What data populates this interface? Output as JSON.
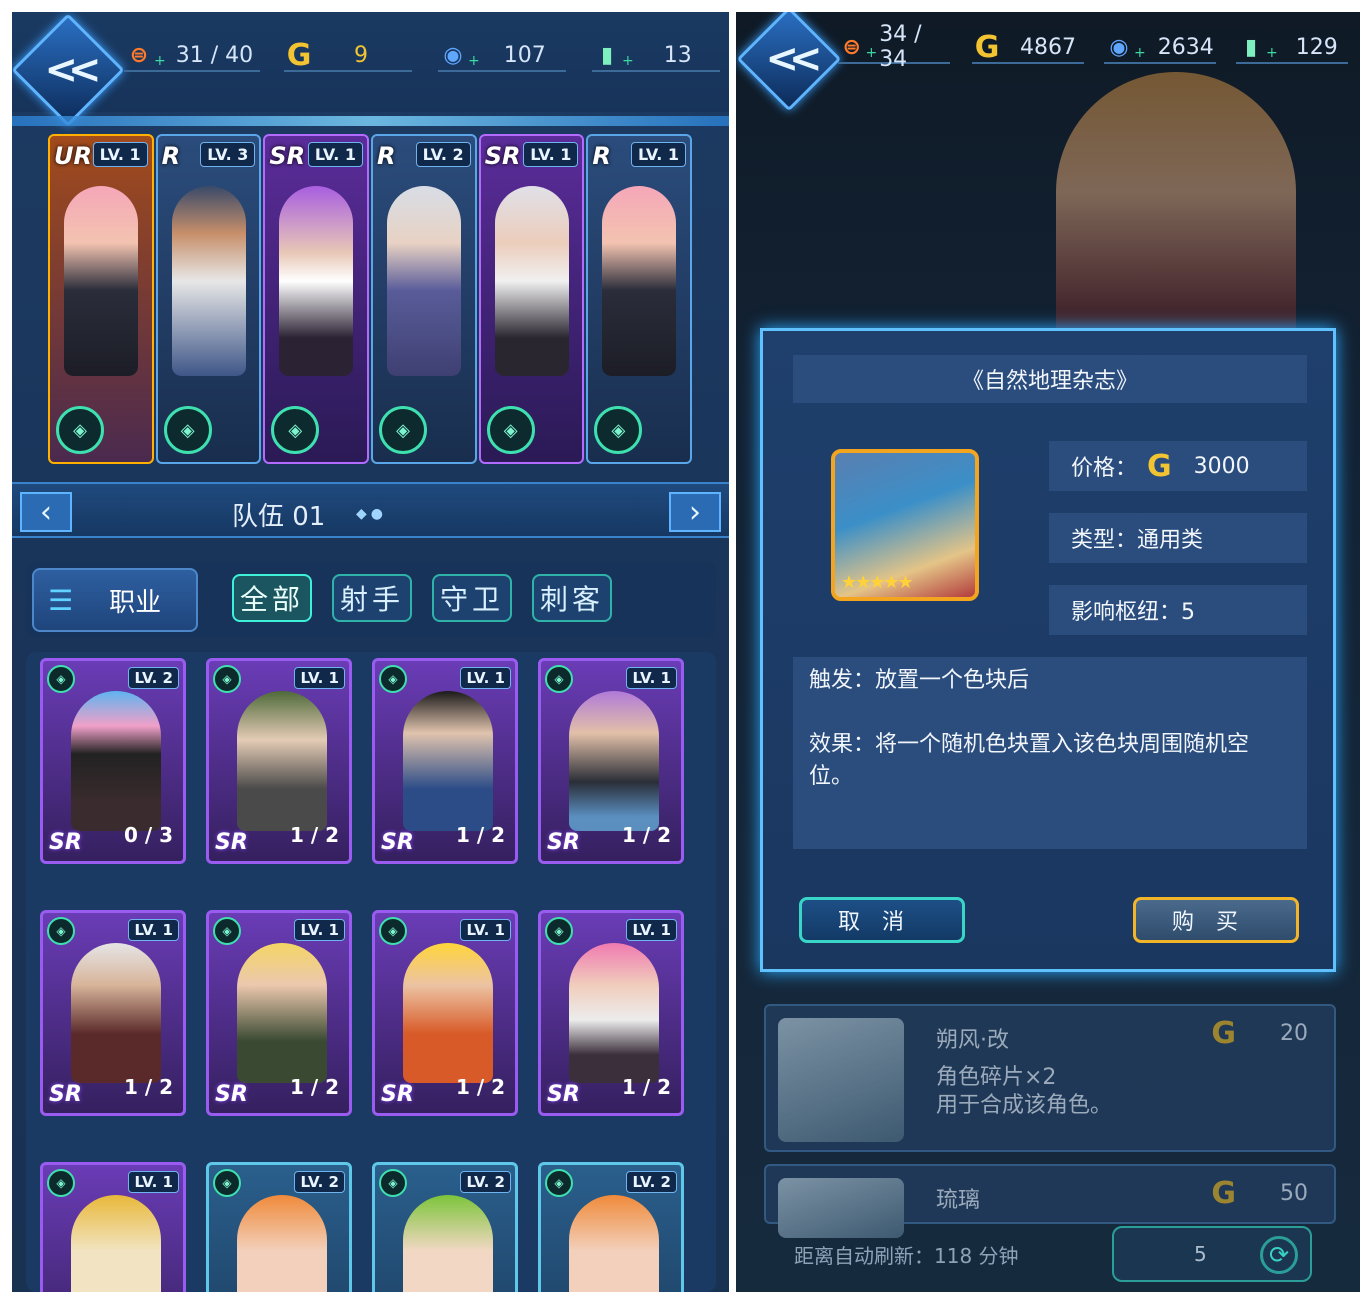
{
  "left_screen": {
    "resources": [
      {
        "icon": "stamina-icon",
        "value": "31 / 40",
        "color": "#ff7a2a"
      },
      {
        "icon": "gold-coin-icon",
        "value": "9",
        "color": "#f2c431"
      },
      {
        "icon": "gem-icon",
        "value": "107",
        "color": "#5fa6ff"
      },
      {
        "icon": "bottle-icon",
        "value": "13",
        "color": "#7ef0c0"
      }
    ],
    "team": [
      {
        "rarity": "UR",
        "level": "LV. 1"
      },
      {
        "rarity": "R",
        "level": "LV. 3"
      },
      {
        "rarity": "SR",
        "level": "LV. 1"
      },
      {
        "rarity": "R",
        "level": "LV. 2"
      },
      {
        "rarity": "SR",
        "level": "LV. 1"
      },
      {
        "rarity": "R",
        "level": "LV. 1"
      }
    ],
    "team_name": "队伍 01",
    "job_label": "职业",
    "filters": [
      "全部",
      "射手",
      "守卫",
      "刺客"
    ],
    "roster": [
      {
        "level": "LV. 2",
        "progress": "0 / 3",
        "rarity": "SR"
      },
      {
        "level": "LV. 1",
        "progress": "1 / 2",
        "rarity": "SR"
      },
      {
        "level": "LV. 1",
        "progress": "1 / 2",
        "rarity": "SR"
      },
      {
        "level": "LV. 1",
        "progress": "1 / 2",
        "rarity": "SR"
      },
      {
        "level": "LV. 1",
        "progress": "1 / 2",
        "rarity": "SR"
      },
      {
        "level": "LV. 1",
        "progress": "1 / 2",
        "rarity": "SR"
      },
      {
        "level": "LV. 1",
        "progress": "1 / 2",
        "rarity": "SR"
      },
      {
        "level": "LV. 1",
        "progress": "1 / 2",
        "rarity": "SR"
      },
      {
        "level": "LV. 1",
        "progress": "",
        "rarity": ""
      },
      {
        "level": "LV. 2",
        "progress": "",
        "rarity": ""
      },
      {
        "level": "LV. 2",
        "progress": "",
        "rarity": ""
      },
      {
        "level": "LV. 2",
        "progress": "",
        "rarity": ""
      }
    ]
  },
  "right_screen": {
    "resources": [
      {
        "icon": "stamina-icon",
        "value": "34 / 34"
      },
      {
        "icon": "gold-coin-icon",
        "value": "4867"
      },
      {
        "icon": "gem-icon",
        "value": "2634"
      },
      {
        "icon": "bottle-icon",
        "value": "129"
      }
    ],
    "dialog": {
      "title": "《自然地理杂志》",
      "price_label": "价格：",
      "price_value": "3000",
      "type_text": "类型：通用类",
      "influence_text": "影响枢纽：5",
      "trigger_text": "触发：放置一个色块后",
      "effect_text": "效果：将一个随机色块置入该色块周围随机空位。",
      "cancel_label": "取消",
      "buy_label": "购买"
    },
    "shop_items": [
      {
        "name": "朔风·改",
        "price": "20",
        "desc_line1": "角色碎片×2",
        "desc_line2": "用于合成该角色。"
      },
      {
        "name": "琉璃",
        "price": "50"
      }
    ],
    "refresh_text": "距离自动刷新：118 分钟",
    "refresh_cost": "5"
  }
}
